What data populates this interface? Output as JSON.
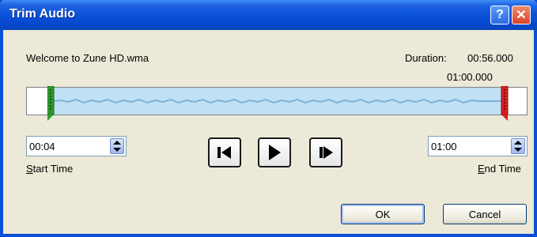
{
  "window": {
    "title": "Trim Audio",
    "help_label": "?",
    "close_label": "✕"
  },
  "file": {
    "name": "Welcome to Zune HD.wma",
    "duration_label": "Duration:",
    "duration_value": "00:56.000",
    "end_marker_time": "01:00.000"
  },
  "trim": {
    "start_fraction": 0.05,
    "end_fraction": 0.95
  },
  "start_time": {
    "value": "00:04",
    "label_prefix": "S",
    "label_rest": "tart Time"
  },
  "end_time": {
    "value": "01:00",
    "label_prefix": "E",
    "label_rest": "nd Time"
  },
  "buttons": {
    "ok": "OK",
    "cancel": "Cancel"
  },
  "icons": {
    "previous_frame": "previous-frame-icon",
    "play": "play-icon",
    "next_frame": "next-frame-icon",
    "spin": "spin-arrows-icon"
  },
  "colors": {
    "titlebar": "#0a52d8",
    "start_handle": "#2e9b2e",
    "end_handle": "#d82020",
    "selection": "#bfe0f5"
  }
}
